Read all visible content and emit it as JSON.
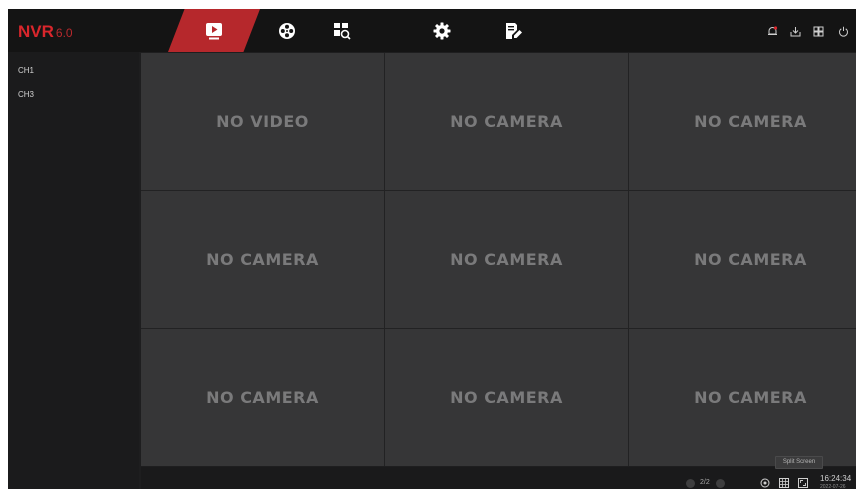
{
  "app": {
    "logo": "NVR",
    "version": "6.0"
  },
  "nav": [
    {
      "name": "live-view",
      "icon": "play-icon",
      "active": true
    },
    {
      "name": "playback",
      "icon": "reel-icon"
    },
    {
      "name": "search",
      "icon": "search-grid-icon"
    },
    {
      "name": "settings",
      "icon": "gear-icon"
    },
    {
      "name": "maintenance",
      "icon": "edit-doc-icon"
    }
  ],
  "toolbar": [
    "alarm-icon",
    "download-icon",
    "grid-icon",
    "power-icon"
  ],
  "channels": [
    {
      "label": "CH1"
    },
    {
      "label": "CH3"
    }
  ],
  "grid": {
    "cells": [
      {
        "label": "NO VIDEO"
      },
      {
        "label": "NO CAMERA"
      },
      {
        "label": "NO CAMERA"
      },
      {
        "label": "NO CAMERA"
      },
      {
        "label": "NO CAMERA"
      },
      {
        "label": "NO CAMERA"
      },
      {
        "label": "NO CAMERA"
      },
      {
        "label": "NO CAMERA"
      },
      {
        "label": "NO CAMERA"
      }
    ]
  },
  "bottom": {
    "page": "2/2",
    "tooltip": "Split Screen",
    "time": "16:24:34",
    "date": "2022-07-26"
  },
  "colors": {
    "accent": "#b6282c",
    "logo": "#d9262c",
    "background": "#1e1e1f",
    "cell": "#363637",
    "cell_text": "#7a7a7b"
  }
}
